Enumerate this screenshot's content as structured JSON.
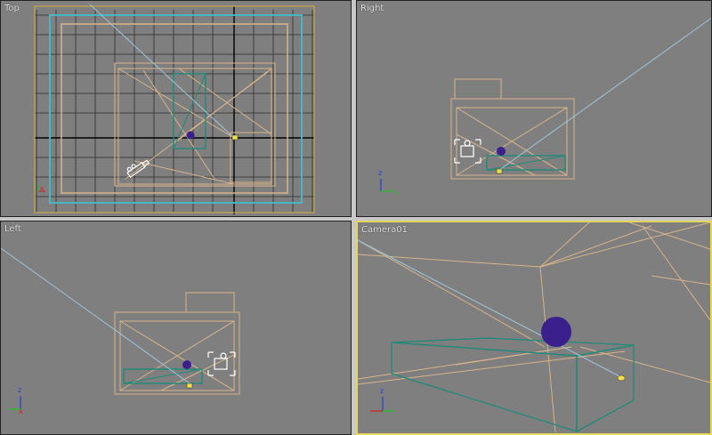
{
  "viewports": {
    "top": {
      "label": "Top"
    },
    "right": {
      "label": "Right"
    },
    "left": {
      "label": "Left"
    },
    "camera": {
      "label": "Camera01",
      "active": true
    }
  },
  "colors": {
    "background": "#7f7f7f",
    "grid": "#2c2c2c",
    "wire": "#d8b48a",
    "teal": "#1f8a7a",
    "cyan": "#47b6c4",
    "sphere": "#3b1f8c",
    "light": "#f0e14a",
    "active_border": "#e6d65a",
    "axis_x": "#d02020",
    "axis_y": "#20c020",
    "axis_z": "#2040d0"
  },
  "axis": {
    "x": "x",
    "y": "y",
    "z": "z"
  }
}
